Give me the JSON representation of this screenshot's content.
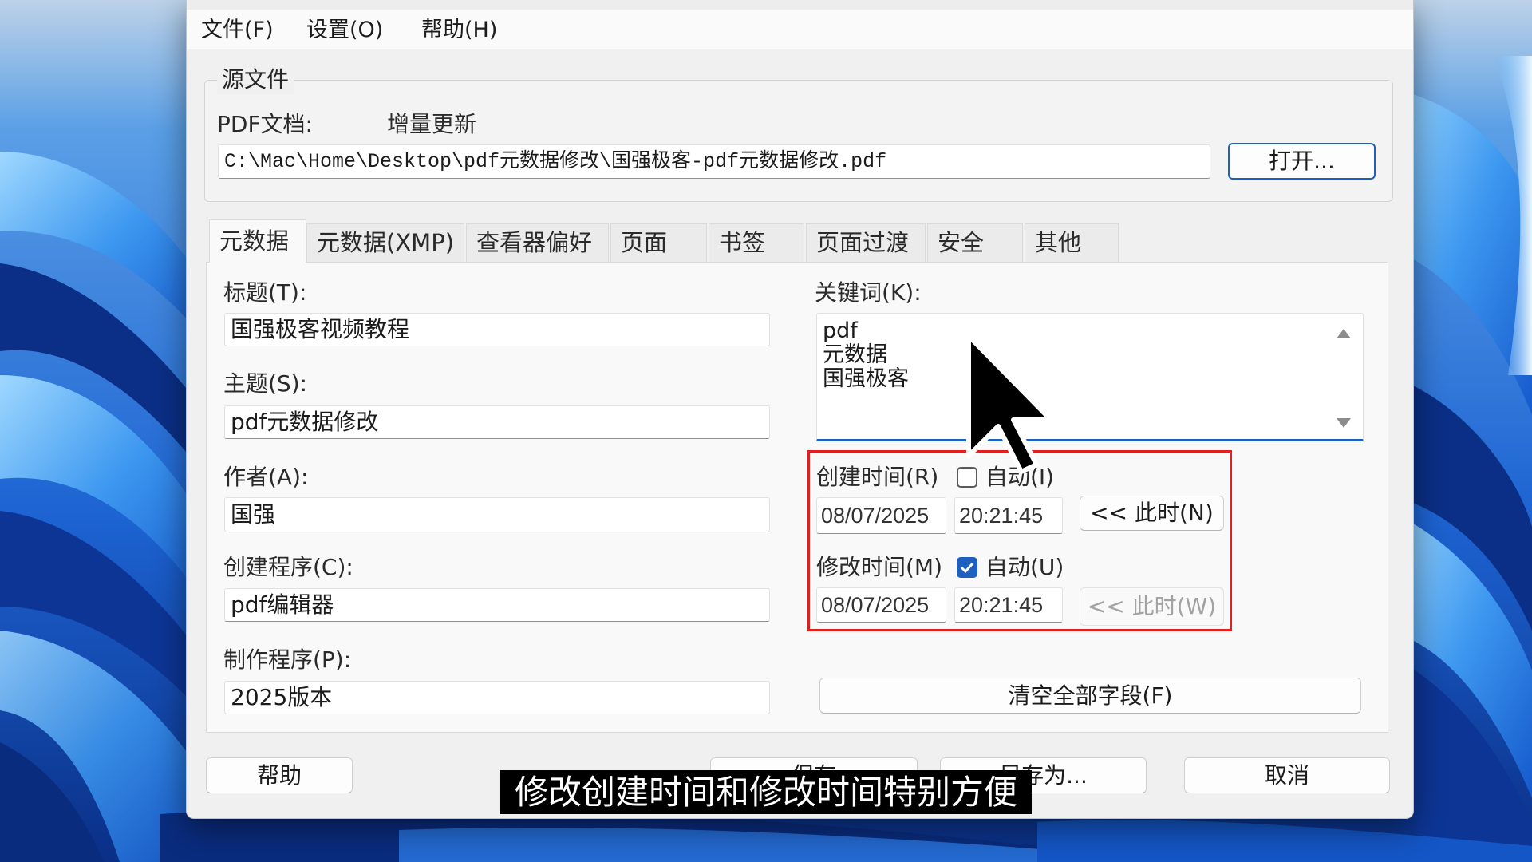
{
  "colors": {
    "accent": "#1f5fbf",
    "highlight": "#e02020",
    "subtitle_bg": "#000000"
  },
  "menu": [
    {
      "label": "文件(F)"
    },
    {
      "label": "设置(O)"
    },
    {
      "label": "帮助(H)"
    }
  ],
  "source": {
    "group_label": "源文件",
    "pdf_label": "PDF文档:",
    "mode": "增量更新",
    "path": "C:\\Mac\\Home\\Desktop\\pdf元数据修改\\国强极客-pdf元数据修改.pdf",
    "open_button": "打开..."
  },
  "tabs": [
    {
      "label": "元数据",
      "selected": true
    },
    {
      "label": "元数据(XMP)",
      "selected": false
    },
    {
      "label": "查看器偏好",
      "selected": false
    },
    {
      "label": "页面",
      "selected": false
    },
    {
      "label": "书签",
      "selected": false
    },
    {
      "label": "页面过渡",
      "selected": false
    },
    {
      "label": "安全",
      "selected": false
    },
    {
      "label": "其他",
      "selected": false
    }
  ],
  "metadata": {
    "title_label": "标题(T):",
    "title_value": "国强极客视频教程",
    "subject_label": "主题(S):",
    "subject_value": "pdf元数据修改",
    "author_label": "作者(A):",
    "author_value": "国强",
    "creator_label": "创建程序(C):",
    "creator_value": "pdf编辑器",
    "producer_label": "制作程序(P):",
    "producer_value": "2025版本",
    "keywords_label": "关键词(K):",
    "keywords": [
      "pdf",
      "元数据",
      "国强极客"
    ],
    "created": {
      "label": "创建时间(R)",
      "auto_label": "自动(I)",
      "auto_checked": false,
      "date": "08/07/2025",
      "time": "20:21:45",
      "now_button": "<< 此时(N)",
      "now_enabled": true
    },
    "modified": {
      "label": "修改时间(M)",
      "auto_label": "自动(U)",
      "auto_checked": true,
      "date": "08/07/2025",
      "time": "20:21:45",
      "now_button": "<< 此时(W)",
      "now_enabled": false
    },
    "clear_button": "清空全部字段(F)"
  },
  "buttons": {
    "help": "帮助",
    "save": "保存",
    "save_as": "另存为...",
    "cancel": "取消"
  },
  "subtitle": "修改创建时间和修改时间特别方便",
  "icons": {
    "scroll_up": "scroll-up-arrow-icon",
    "scroll_down": "scroll-down-arrow-icon",
    "check": "checkmark-icon",
    "cursor": "mouse-cursor-icon"
  }
}
